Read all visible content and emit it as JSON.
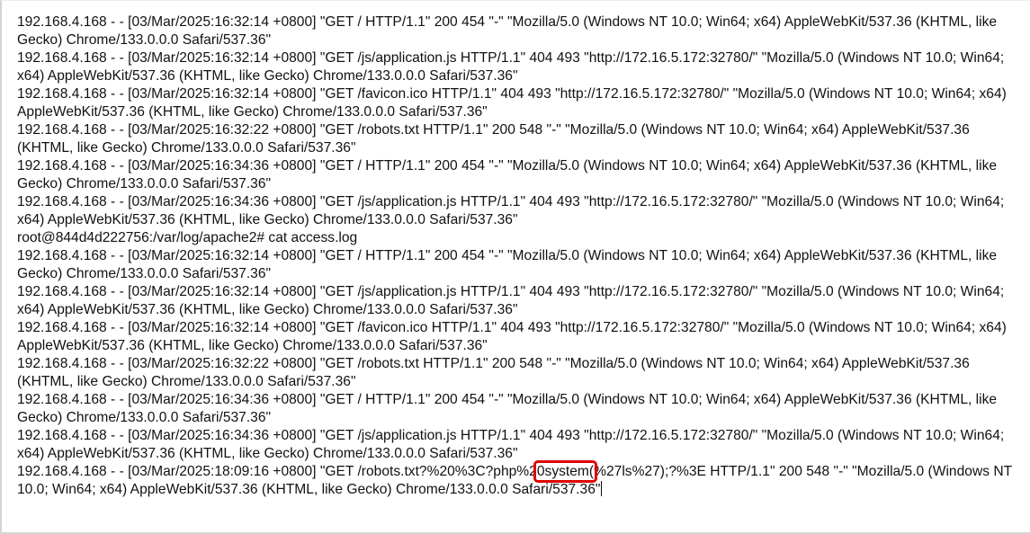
{
  "terminal": {
    "lines": [
      "192.168.4.168 - - [03/Mar/2025:16:32:14 +0800] \"GET / HTTP/1.1\" 200 454 \"-\" \"Mozilla/5.0 (Windows NT 10.0; Win64; x64) AppleWebKit/537.36 (KHTML, like Gecko) Chrome/133.0.0.0 Safari/537.36\"",
      "192.168.4.168 - - [03/Mar/2025:16:32:14 +0800] \"GET /js/application.js HTTP/1.1\" 404 493 \"http://172.16.5.172:32780/\" \"Mozilla/5.0 (Windows NT 10.0; Win64; x64) AppleWebKit/537.36 (KHTML, like Gecko) Chrome/133.0.0.0 Safari/537.36\"",
      "192.168.4.168 - - [03/Mar/2025:16:32:14 +0800] \"GET /favicon.ico HTTP/1.1\" 404 493 \"http://172.16.5.172:32780/\" \"Mozilla/5.0 (Windows NT 10.0; Win64; x64) AppleWebKit/537.36 (KHTML, like Gecko) Chrome/133.0.0.0 Safari/537.36\"",
      "192.168.4.168 - - [03/Mar/2025:16:32:22 +0800] \"GET /robots.txt HTTP/1.1\" 200 548 \"-\" \"Mozilla/5.0 (Windows NT 10.0; Win64; x64) AppleWebKit/537.36 (KHTML, like Gecko) Chrome/133.0.0.0 Safari/537.36\"",
      "192.168.4.168 - - [03/Mar/2025:16:34:36 +0800] \"GET / HTTP/1.1\" 200 454 \"-\" \"Mozilla/5.0 (Windows NT 10.0; Win64; x64) AppleWebKit/537.36 (KHTML, like Gecko) Chrome/133.0.0.0 Safari/537.36\"",
      "192.168.4.168 - - [03/Mar/2025:16:34:36 +0800] \"GET /js/application.js HTTP/1.1\" 404 493 \"http://172.16.5.172:32780/\" \"Mozilla/5.0 (Windows NT 10.0; Win64; x64) AppleWebKit/537.36 (KHTML, like Gecko) Chrome/133.0.0.0 Safari/537.36\"",
      "root@844d4d222756:/var/log/apache2# cat  access.log",
      "192.168.4.168 - - [03/Mar/2025:16:32:14 +0800] \"GET / HTTP/1.1\" 200 454 \"-\" \"Mozilla/5.0 (Windows NT 10.0; Win64; x64) AppleWebKit/537.36 (KHTML, like Gecko) Chrome/133.0.0.0 Safari/537.36\"",
      "192.168.4.168 - - [03/Mar/2025:16:32:14 +0800] \"GET /js/application.js HTTP/1.1\" 404 493 \"http://172.16.5.172:32780/\" \"Mozilla/5.0 (Windows NT 10.0; Win64; x64) AppleWebKit/537.36 (KHTML, like Gecko) Chrome/133.0.0.0 Safari/537.36\"",
      "192.168.4.168 - - [03/Mar/2025:16:32:14 +0800] \"GET /favicon.ico HTTP/1.1\" 404 493 \"http://172.16.5.172:32780/\" \"Mozilla/5.0 (Windows NT 10.0; Win64; x64) AppleWebKit/537.36 (KHTML, like Gecko) Chrome/133.0.0.0 Safari/537.36\"",
      "192.168.4.168 - - [03/Mar/2025:16:32:22 +0800] \"GET /robots.txt HTTP/1.1\" 200 548 \"-\" \"Mozilla/5.0 (Windows NT 10.0; Win64; x64) AppleWebKit/537.36 (KHTML, like Gecko) Chrome/133.0.0.0 Safari/537.36\"",
      "192.168.4.168 - - [03/Mar/2025:16:34:36 +0800] \"GET / HTTP/1.1\" 200 454 \"-\" \"Mozilla/5.0 (Windows NT 10.0; Win64; x64) AppleWebKit/537.36 (KHTML, like Gecko) Chrome/133.0.0.0 Safari/537.36\"",
      "192.168.4.168 - - [03/Mar/2025:16:34:36 +0800] \"GET /js/application.js HTTP/1.1\" 404 493 \"http://172.16.5.172:32780/\" \"Mozilla/5.0 (Windows NT 10.0; Win64; x64) AppleWebKit/537.36 (KHTML, like Gecko) Chrome/133.0.0.0 Safari/537.36\""
    ],
    "last_line": {
      "before": "192.168.4.168 - - [03/Mar/2025:18:09:16 +0800] \"GET /robots.txt?%20%3C?php%2",
      "highlighted": "0system(",
      "after": "%27ls%27);?%3E HTTP/1.1\" 200 548 \"-\" \"Mozilla/5.0 (Windows NT 10.0; Win64; x64) AppleWebKit/537.36 (KHTML, like Gecko) Chrome/133.0.0.0 Safari/537.36\""
    }
  },
  "colors": {
    "text": "#111111",
    "highlight_box": "#e00000",
    "background": "#ffffff"
  }
}
